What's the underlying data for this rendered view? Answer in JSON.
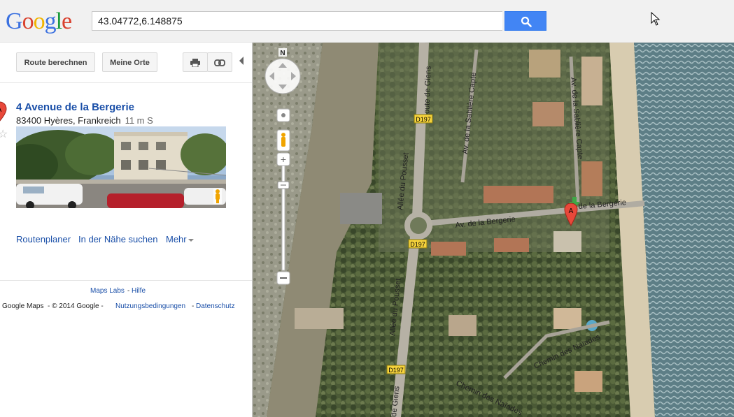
{
  "header": {
    "logo_letters": [
      {
        "char": "G",
        "color": "#3b71e0"
      },
      {
        "char": "o",
        "color": "#d9412e"
      },
      {
        "char": "o",
        "color": "#f1b400"
      },
      {
        "char": "g",
        "color": "#3b71e0"
      },
      {
        "char": "l",
        "color": "#1a9b3c"
      },
      {
        "char": "e",
        "color": "#d9412e"
      }
    ],
    "search_value": "43.04772,6.148875"
  },
  "toolbar": {
    "route_label": "Route berechnen",
    "places_label": "Meine Orte"
  },
  "place": {
    "title": "4 Avenue de la Bergerie",
    "address": "83400 Hyères, Frankreich",
    "distance": "11 m S",
    "marker_letter": "A"
  },
  "actions": {
    "directions": "Routenplaner",
    "nearby": "In der Nähe suchen",
    "more": "Mehr"
  },
  "footer": {
    "maps_labs": "Maps Labs",
    "separator": "-",
    "help": "Hilfe",
    "copyright": "Google Maps  - © 2014 Google - ",
    "terms": "Nutzungsbedingungen",
    "privacy": "Datenschutz"
  },
  "map": {
    "compass_north": "N",
    "marker_letter": "A",
    "labels": {
      "route_giens": "Route de Giens",
      "allee_sabliere": "Av. de la Sablière Capte",
      "av_sabliere_right": "Av. de la Sablière Capte",
      "allee_pousset_top": "Allée du Pousset",
      "allee_pousset_bottom": "Allée du Pousset",
      "av_bergerie": "Av. de la Bergerie",
      "de_la_bergerie": "de la Bergerie",
      "chemin_naiades_1": "Chemin des Naïades",
      "chemin_naiades_2": "Chemin des Naïades",
      "route_giens_bottom": "de Giens",
      "d197_1": "D197",
      "d197_2": "D197",
      "d197_3": "D197"
    }
  }
}
